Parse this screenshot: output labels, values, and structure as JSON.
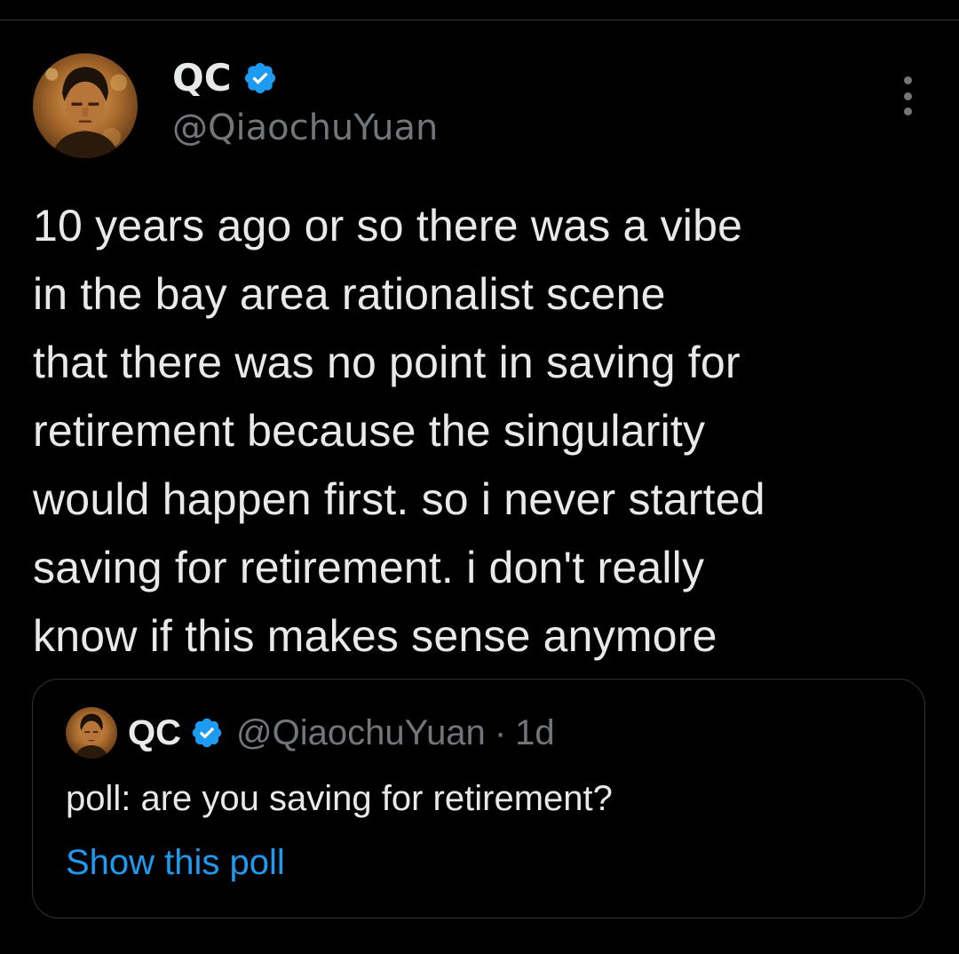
{
  "tweet": {
    "author": {
      "display_name": "QC",
      "handle": "@QiaochuYuan",
      "verified": true,
      "avatar_icon": "profile-photo"
    },
    "text": "10 years ago or so there was a vibe\nin the bay area rationalist scene\nthat there was no point in saving for\nretirement because the singularity\nwould happen first. so i never started\nsaving for retirement. i don't really\nknow if this makes sense anymore",
    "more_icon": "more-options-icon"
  },
  "quoted_tweet": {
    "author": {
      "display_name": "QC",
      "handle": "@QiaochuYuan",
      "verified": true
    },
    "separator": "·",
    "time": "1d",
    "text": "poll: are you saving for retirement?",
    "link_label": "Show this poll"
  },
  "colors": {
    "background": "#000000",
    "text_primary": "#e7e9ea",
    "text_secondary": "#71767b",
    "border": "#2f3336",
    "accent": "#1d9bf0"
  }
}
